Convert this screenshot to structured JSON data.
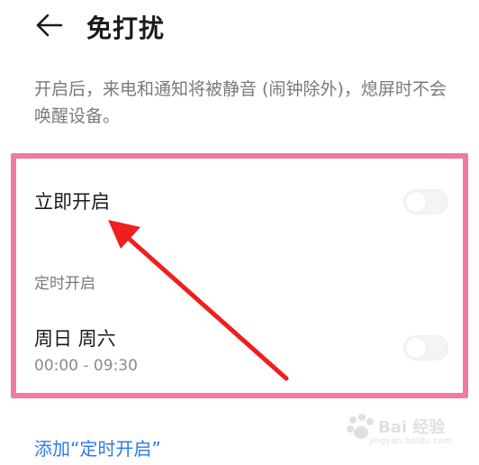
{
  "header": {
    "title": "免打扰",
    "back_icon": "arrow-left-icon"
  },
  "description": "开启后，来电和通知将被静音 (闹钟除外)，熄屏时不会唤醒设备。",
  "immediate": {
    "label": "立即开启",
    "enabled": false
  },
  "schedule": {
    "section_title": "定时开启",
    "days": "周日 周六",
    "time_range": "00:00 - 09:30",
    "enabled": false
  },
  "add_schedule": {
    "label": "添加“定时开启”"
  },
  "annotation": {
    "frame_color": "#f27aa0",
    "arrow_color": "#f01e1e"
  },
  "watermark": {
    "brand": "Bai 经验",
    "url": "jingyan.baidu.com"
  },
  "colors": {
    "link": "#2f7ae5",
    "secondary_text": "#7a7a7a"
  }
}
